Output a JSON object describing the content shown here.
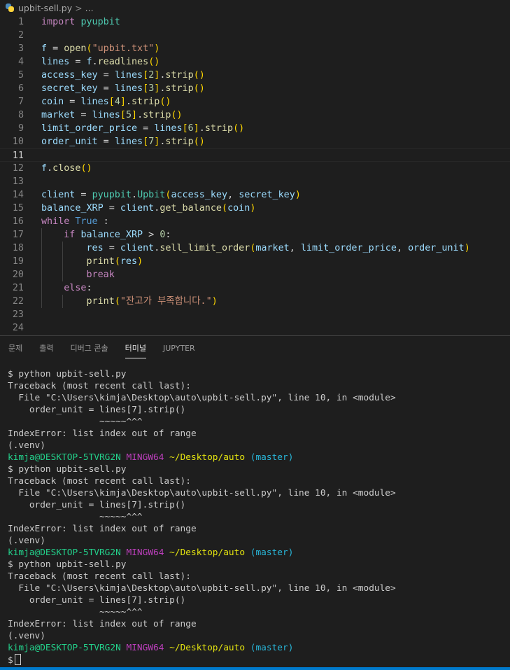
{
  "breadcrumb": {
    "file": "upbit-sell.py",
    "separator": ">",
    "more": "..."
  },
  "editor": {
    "current_line": 11,
    "lines": [
      {
        "n": "1",
        "html": "<span class=\"kw\">import</span> <span class=\"cls\">pyupbit</span>"
      },
      {
        "n": "2",
        "html": ""
      },
      {
        "n": "3",
        "html": "<span class=\"var\">f</span> = <span class=\"fn\">open</span><span class=\"b1\">(</span><span class=\"str\">\"upbit.txt\"</span><span class=\"b1\">)</span>"
      },
      {
        "n": "4",
        "html": "<span class=\"var\">lines</span> = <span class=\"var\">f</span>.<span class=\"fn\">readlines</span><span class=\"b1\">()</span>"
      },
      {
        "n": "5",
        "html": "<span class=\"var\">access_key</span> = <span class=\"var\">lines</span><span class=\"b1\">[</span><span class=\"num\">2</span><span class=\"b1\">]</span>.<span class=\"fn\">strip</span><span class=\"b1\">()</span>"
      },
      {
        "n": "6",
        "html": "<span class=\"var\">secret_key</span> = <span class=\"var\">lines</span><span class=\"b1\">[</span><span class=\"num\">3</span><span class=\"b1\">]</span>.<span class=\"fn\">strip</span><span class=\"b1\">()</span>"
      },
      {
        "n": "7",
        "html": "<span class=\"var\">coin</span> = <span class=\"var\">lines</span><span class=\"b1\">[</span><span class=\"num\">4</span><span class=\"b1\">]</span>.<span class=\"fn\">strip</span><span class=\"b1\">()</span>"
      },
      {
        "n": "8",
        "html": "<span class=\"var\">market</span> = <span class=\"var\">lines</span><span class=\"b1\">[</span><span class=\"num\">5</span><span class=\"b1\">]</span>.<span class=\"fn\">strip</span><span class=\"b1\">()</span>"
      },
      {
        "n": "9",
        "html": "<span class=\"var\">limit_order_price</span> = <span class=\"var\">lines</span><span class=\"b1\">[</span><span class=\"num\">6</span><span class=\"b1\">]</span>.<span class=\"fn\">strip</span><span class=\"b1\">()</span>"
      },
      {
        "n": "10",
        "html": "<span class=\"var\">order_unit</span> = <span class=\"var\">lines</span><span class=\"b1\">[</span><span class=\"num\">7</span><span class=\"b1\">]</span>.<span class=\"fn\">strip</span><span class=\"b1\">()</span>"
      },
      {
        "n": "11",
        "html": ""
      },
      {
        "n": "12",
        "html": "<span class=\"var\">f</span>.<span class=\"fn\">close</span><span class=\"b1\">()</span>"
      },
      {
        "n": "13",
        "html": ""
      },
      {
        "n": "14",
        "html": "<span class=\"var\">client</span> = <span class=\"cls\">pyupbit</span>.<span class=\"cls\">Upbit</span><span class=\"b1\">(</span><span class=\"var\">access_key</span>, <span class=\"var\">secret_key</span><span class=\"b1\">)</span>"
      },
      {
        "n": "15",
        "html": "<span class=\"var\">balance_XRP</span> = <span class=\"var\">client</span>.<span class=\"fn\">get_balance</span><span class=\"b1\">(</span><span class=\"var\">coin</span><span class=\"b1\">)</span>"
      },
      {
        "n": "16",
        "html": "<span class=\"kw\">while</span> <span class=\"const\">True</span> :"
      },
      {
        "n": "17",
        "html": "    <span class=\"kw\">if</span> <span class=\"var\">balance_XRP</span> &gt; <span class=\"num\">0</span>:"
      },
      {
        "n": "18",
        "html": "        <span class=\"var\">res</span> = <span class=\"var\">client</span>.<span class=\"fn\">sell_limit_order</span><span class=\"b1\">(</span><span class=\"var\">market</span>, <span class=\"var\">limit_order_price</span>, <span class=\"var\">order_unit</span><span class=\"b1\">)</span>"
      },
      {
        "n": "19",
        "html": "        <span class=\"fn\">print</span><span class=\"b1\">(</span><span class=\"var\">res</span><span class=\"b1\">)</span>"
      },
      {
        "n": "20",
        "html": "        <span class=\"kw\">break</span>"
      },
      {
        "n": "21",
        "html": "    <span class=\"kw\">else</span>:"
      },
      {
        "n": "22",
        "html": "        <span class=\"fn\">print</span><span class=\"b1\">(</span><span class=\"str\">\"잔고가 부족합니다.\"</span><span class=\"b1\">)</span>"
      },
      {
        "n": "23",
        "html": ""
      },
      {
        "n": "24",
        "html": ""
      }
    ]
  },
  "panel": {
    "tabs": [
      {
        "label": "문제",
        "active": false
      },
      {
        "label": "출력",
        "active": false
      },
      {
        "label": "디버그 콘솔",
        "active": false
      },
      {
        "label": "터미널",
        "active": true
      },
      {
        "label": "JUPYTER",
        "active": false
      }
    ]
  },
  "terminal": {
    "lines": [
      "$ python upbit-sell.py",
      "Traceback (most recent call last):",
      "  File \"C:\\Users\\kimja\\Desktop\\auto\\upbit-sell.py\", line 10, in <module>",
      "    order_unit = lines[7].strip()",
      "                 ~~~~~^^^",
      "IndexError: list index out of range",
      "(.venv)",
      {
        "user": "kimja@DESKTOP-5TVRG2N",
        "env": "MINGW64",
        "path": "~/Desktop/auto",
        "branch": "(master)"
      },
      "$ python upbit-sell.py",
      "Traceback (most recent call last):",
      "  File \"C:\\Users\\kimja\\Desktop\\auto\\upbit-sell.py\", line 10, in <module>",
      "    order_unit = lines[7].strip()",
      "                 ~~~~~^^^",
      "IndexError: list index out of range",
      "(.venv)",
      {
        "user": "kimja@DESKTOP-5TVRG2N",
        "env": "MINGW64",
        "path": "~/Desktop/auto",
        "branch": "(master)"
      },
      "$ python upbit-sell.py",
      "Traceback (most recent call last):",
      "  File \"C:\\Users\\kimja\\Desktop\\auto\\upbit-sell.py\", line 10, in <module>",
      "    order_unit = lines[7].strip()",
      "                 ~~~~~^^^",
      "IndexError: list index out of range",
      "(.venv)",
      {
        "user": "kimja@DESKTOP-5TVRG2N",
        "env": "MINGW64",
        "path": "~/Desktop/auto",
        "branch": "(master)"
      },
      {
        "prompt": "$"
      }
    ]
  }
}
